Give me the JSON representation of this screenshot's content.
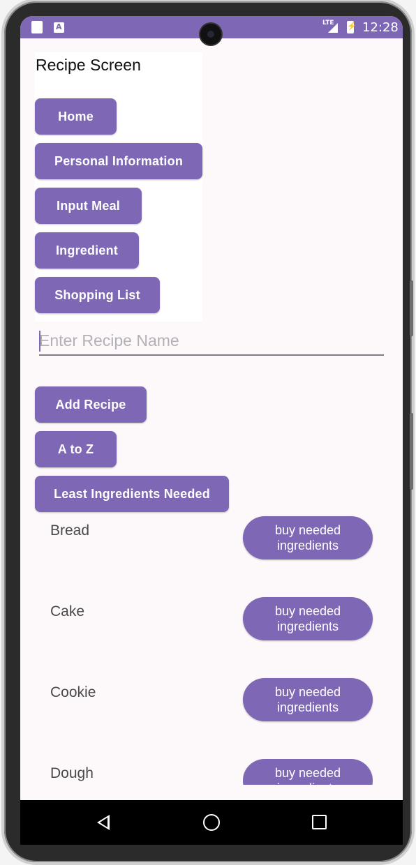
{
  "status_bar": {
    "time": "12:28",
    "network": "LTE",
    "icons": [
      "sd-card-icon",
      "app-notification-icon",
      "signal-icon",
      "battery-charging-icon"
    ]
  },
  "screen_title": "Recipe Screen",
  "nav_buttons": [
    "Home",
    "Personal Information",
    "Input Meal",
    "Ingredient",
    "Shopping List"
  ],
  "recipe_input": {
    "placeholder": "Enter Recipe Name",
    "value": ""
  },
  "actions": {
    "add_recipe": "Add Recipe",
    "sort_a_to_z": "A to Z",
    "sort_least_ingredients": "Least Ingredients Needed"
  },
  "recipes": [
    {
      "name": "Bread",
      "button": "buy needed ingredients"
    },
    {
      "name": "Cake",
      "button": "buy needed ingredients"
    },
    {
      "name": "Cookie",
      "button": "buy needed ingredients"
    },
    {
      "name": "Dough",
      "button": "buy needed ingredients"
    }
  ],
  "colors": {
    "accent": "#7e67b4",
    "background": "#fdf9fb"
  }
}
